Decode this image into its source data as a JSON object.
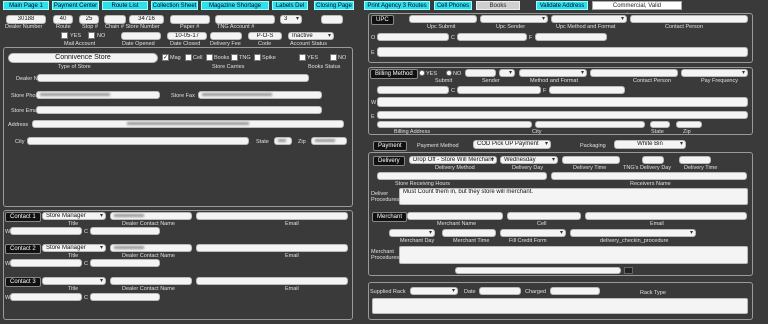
{
  "toolbar": {
    "main_page": "Main Page 1",
    "payment_center": "Payment Center",
    "route_list": "Route List",
    "collection_sheet": "Collection Sheet",
    "magazine_shortage": "Magazine Shortage",
    "labels_del": "Labels Del",
    "closing_page": "Closing Page",
    "print_agency": "Print Agency 3 Routes",
    "cell_phones": "Cell Phones",
    "books": "Books",
    "validate_address": "Validate Address",
    "validation_status": "Commercial, Valid"
  },
  "top_fields": {
    "dealer_number": "30188",
    "route": "40",
    "stop": "25",
    "store_number": "34716",
    "tng_count": "3",
    "date_closed": "10-05-17",
    "code": "P-O-S",
    "account_status": "Inactive"
  },
  "top_labels": {
    "dealer_number": "Dealer Number",
    "route": "Route",
    "stop": "Stop #",
    "chain_store": "Chain # Store Number",
    "paper": "Paper #",
    "tng_account": "TNG Account #",
    "mail_account": "Mail Account",
    "date_opened": "Date Opened",
    "date_closed": "Date Closed",
    "delivery_fee": "Delivery Fee",
    "code": "Code",
    "account_status": "Account Status",
    "yes": "YES",
    "no": "NO"
  },
  "store": {
    "type": "Connivence Store",
    "type_label": "Type of Store",
    "carries_label": "Store Carries",
    "status_label": "Books Status",
    "carries": [
      {
        "label": "Mag",
        "checked": true
      },
      {
        "label": "Cell",
        "checked": false
      },
      {
        "label": "Books",
        "checked": false
      },
      {
        "label": "TNG",
        "checked": false
      },
      {
        "label": "Spike",
        "checked": false
      }
    ],
    "dealer_name_label": "Dealer Name",
    "phone_label": "Store Phone",
    "fax_label": "Store Fax",
    "email_label": "Store Email",
    "address_label": "Address",
    "city_label": "City",
    "state_label": "State",
    "zip_label": "Zip"
  },
  "contacts": {
    "items": [
      {
        "tag": "Contact 1",
        "role": "Store Manager"
      },
      {
        "tag": "Contact 2",
        "role": "Store Manager"
      },
      {
        "tag": "Contact 3",
        "role": ""
      }
    ],
    "title_label": "Title",
    "name_label": "Dealer Contact Name",
    "email_label": "Email",
    "w": "W",
    "c": "C"
  },
  "upc": {
    "header": "UPC",
    "submit": "Upc Submit",
    "sender": "Upc Sender",
    "method": "Upc Method and Format",
    "contact": "Contact Person",
    "o": "O",
    "c": "C",
    "f": "F",
    "e": "E"
  },
  "billing": {
    "header": "Billing Method",
    "yes": "YES",
    "no": "NO",
    "submit": "Submit",
    "sender": "Sender",
    "method": "Method and Format",
    "contact": "Contact Person",
    "frequency": "Pay Frequency",
    "o": "O",
    "c": "C",
    "f": "F",
    "w": "W",
    "e": "E",
    "address": "Billing Address",
    "city": "City",
    "state": "State",
    "zip": "Zip"
  },
  "payment": {
    "header": "Payment",
    "method_label": "Payment Method",
    "method": "COD Pick UP Payment",
    "packaging_label": "Packaging",
    "packaging": "White Bin"
  },
  "delivery": {
    "header": "Delivery",
    "method": "Drop Off - Store Will Merchant",
    "day": "Wednesday",
    "method_label": "Delivery Method",
    "day_label": "Delivery Day",
    "time_label": "Delivery Time",
    "tng_day_label": "TNG's Delivery Day",
    "tng_time_label": "Delivery Time",
    "hours_label": "Store Receiving Hours",
    "receivers_label": "Receivers Name",
    "procedures_label": "Deliver Procedures",
    "procedures": "Must Count them in, but they store will merchant."
  },
  "merchant": {
    "header": "Merchant",
    "name_label": "Merchant Name",
    "cell_label": "Cell",
    "email_label": "Email",
    "day_label": "Merchant Day",
    "time_label": "Merchant Time",
    "fill_label": "Fill Credit Form",
    "checkin_label": "delivery_checkin_procedure",
    "procedures_label": "Merchant Procedures"
  },
  "rack": {
    "supplied_label": "Supplied Rack",
    "date_label": "Date",
    "charged_label": "Charged",
    "type_label": "Rack Type"
  },
  "colors": {
    "accent": "#2fe0e8",
    "background": "#3a3a3a",
    "arrow": "#e8523a"
  }
}
